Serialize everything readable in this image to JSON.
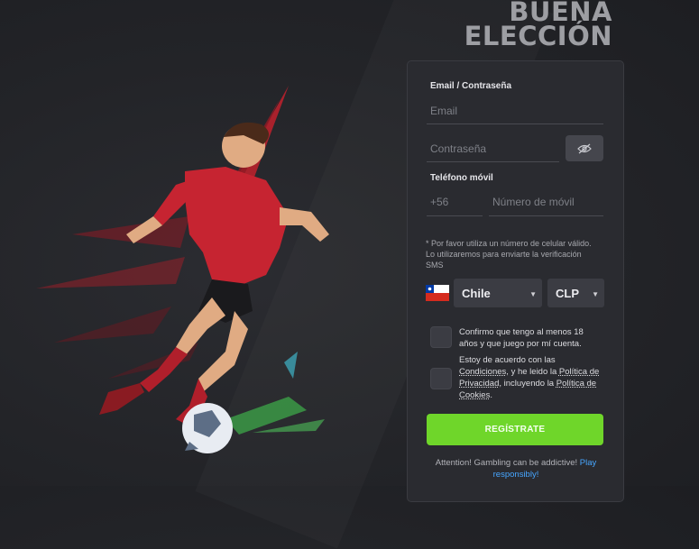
{
  "headline": {
    "line1": "BUENA",
    "line2": "ELECCIÓN"
  },
  "form": {
    "email_password_label": "Email / Contraseña",
    "email_placeholder": "Email",
    "password_placeholder": "Contraseña",
    "phone_label": "Teléfono móvil",
    "phone_prefix": "+56",
    "phone_placeholder": "Número de móvil",
    "phone_note": "* Por favor utiliza un número de celular válido. Lo utilizaremos para enviarte la verificación SMS",
    "country": {
      "selected": "Chile"
    },
    "currency": {
      "selected": "CLP"
    },
    "age_confirm": "Confirmo que tengo al menos 18 años y que juego por mí cuenta.",
    "terms": {
      "prefix": "Estoy de acuerdo con las ",
      "conditions_link": "Condiciones",
      "middle": ", y he leido la ",
      "privacy_link": "Política de Privacidad",
      "suffix": ", incluyendo la ",
      "cookies_link": "Política de Cookies",
      "end": "."
    },
    "register_button": "REGÍSTRATE",
    "warning_text": "Attention! Gambling can be addictive! ",
    "warning_link": "Play responsibly!"
  },
  "icons": {
    "password_toggle": "eye-slash-icon",
    "country_flag": "chile-flag-icon",
    "dropdown": "caret-down-icon"
  },
  "colors": {
    "accent_green": "#6fd62a",
    "link_blue": "#47a6ff",
    "panel_bg": "#2a2b30"
  }
}
